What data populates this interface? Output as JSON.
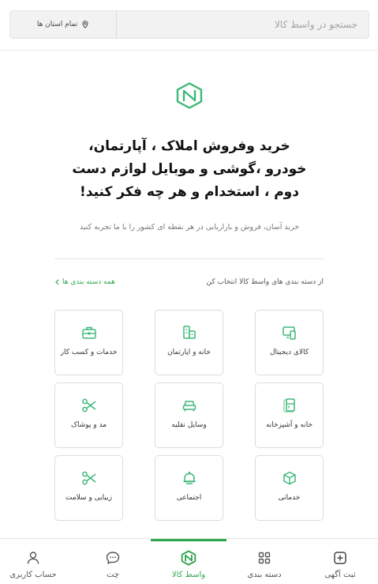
{
  "search": {
    "placeholder": "جستجو در واسط کالا"
  },
  "location": {
    "label": "تمام استان ها",
    "icon": "location-pin-icon"
  },
  "hero": {
    "line1": "خرید وفروش املاک ، آپارتمان،",
    "line2": "خودرو ،گوشی و موبایل لوازم دست",
    "line3": "دوم ، استخدام و هر چه فکر کنید!",
    "subtitle": "خرید آسان، فروش و بازاریابی در هر نقطه ای کشور را با ما تجربه کنید"
  },
  "categories": {
    "title": "از دسته بندی های واسط کالا انتخاب کن",
    "all_link": "همه دسته بندی ها",
    "items": [
      {
        "label": "کالای دیجیتال",
        "icon": "digital-devices-icon"
      },
      {
        "label": "خانه و اپارتمان",
        "icon": "buildings-icon"
      },
      {
        "label": "خدمات و کسب کار",
        "icon": "briefcase-icon"
      },
      {
        "label": "خانه و آشپزخانه",
        "icon": "refrigerator-icon"
      },
      {
        "label": "وسایل نقلیه",
        "icon": "car-icon"
      },
      {
        "label": "مد و پوشاک",
        "icon": "scissors-icon"
      },
      {
        "label": "خدماتی",
        "icon": "box-icon"
      },
      {
        "label": "اجتماعی",
        "icon": "bell-icon"
      },
      {
        "label": "زیبایی و سلامت",
        "icon": "scissors-icon"
      }
    ]
  },
  "nav": {
    "items": [
      {
        "label": "ثبت آگهی",
        "icon": "plus-square-icon"
      },
      {
        "label": "دسته بندی",
        "icon": "grid-icon"
      },
      {
        "label": "واسط کالا",
        "icon": "brand-logo-icon",
        "active": true
      },
      {
        "label": "چت",
        "icon": "chat-bubble-icon"
      },
      {
        "label": "حساب کاربری",
        "icon": "user-icon"
      }
    ]
  },
  "colors": {
    "accent": "#2da44e",
    "icon_green": "#3cb878"
  }
}
